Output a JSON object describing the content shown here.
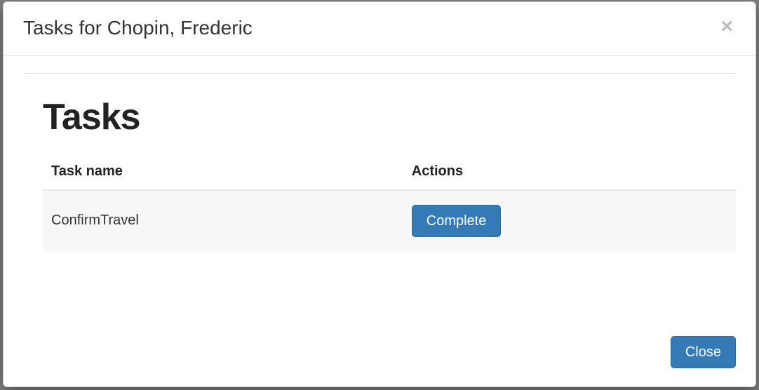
{
  "modal": {
    "title": "Tasks for Chopin, Frederic",
    "close_glyph": "×"
  },
  "section": {
    "heading": "Tasks"
  },
  "table": {
    "columns": {
      "name": "Task name",
      "actions": "Actions"
    },
    "rows": [
      {
        "name": "ConfirmTravel",
        "action_label": "Complete"
      }
    ]
  },
  "footer": {
    "close_label": "Close"
  }
}
